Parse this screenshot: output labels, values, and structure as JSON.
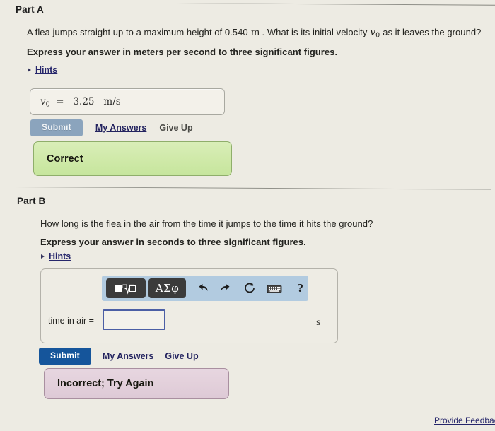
{
  "parts": {
    "a": {
      "title": "Part A",
      "question_prefix": "A flea jumps straight up to a maximum height of 0.540",
      "question_unit": "m",
      "question_middle": ". What is its initial velocity",
      "question_symbol": "v",
      "question_symbol_sub": "0",
      "question_suffix": "as it leaves the ground?",
      "instruction": "Express your answer in meters per second to three significant figures.",
      "hints_label": "Hints",
      "answer_value": "v0  =   3.25    m/s",
      "submit_label": "Submit",
      "my_answers_label": "My Answers",
      "give_up_label": "Give Up",
      "feedback": "Correct"
    },
    "b": {
      "title": "Part B",
      "question": "How long is the flea in the air from the time it jumps to the time it hits the ground?",
      "instruction": "Express your answer in seconds to three significant figures.",
      "hints_label": "Hints",
      "input_label": "time in air =",
      "input_value": "",
      "input_placeholder": "",
      "unit": "s",
      "submit_label": "Submit",
      "my_answers_label": "My Answers",
      "give_up_label": "Give Up",
      "feedback": "Incorrect; Try Again",
      "toolbar": {
        "greek_label": "ΑΣφ",
        "help_label": "?"
      }
    }
  },
  "footer": {
    "provide_feedback": "Provide Feedback"
  },
  "colors": {
    "page_background": "#edebe3",
    "submit_disabled": "#8ba4bd",
    "submit_active": "#15559b",
    "link": "#26266b",
    "correct_box": "#cfe9a8",
    "incorrect_box": "#e2cfda",
    "toolbar": "#b2cbe0",
    "input_border": "#4c5fa5"
  }
}
